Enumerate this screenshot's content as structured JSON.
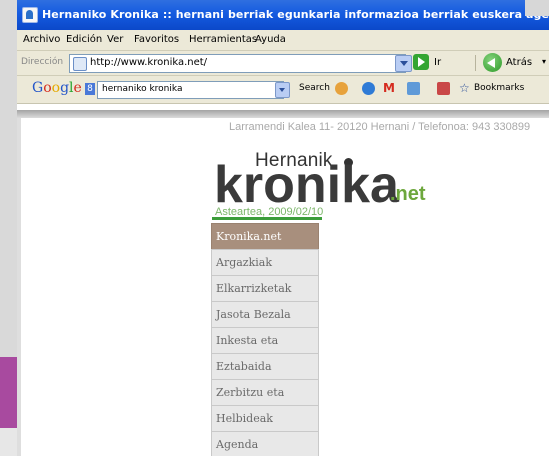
{
  "window": {
    "title": "Hernaniko Kronika :: hernani berriak egunkaria informazioa berriak euskera agenda argazkiak ika - Micro"
  },
  "menubar": {
    "items": [
      "Archivo",
      "Edición",
      "Ver",
      "Favoritos",
      "Herramientas",
      "Ayuda"
    ]
  },
  "addressbar": {
    "label": "Dirección",
    "url": "http://www.kronika.net/",
    "go_label": "Ir",
    "back_label": "Atrás",
    "back_icon": "back-arrow-icon"
  },
  "googlebar": {
    "logo": [
      "G",
      "o",
      "o",
      "g",
      "l",
      "e"
    ],
    "search_query": "hernaniko kronika",
    "search_button": "Search",
    "bookmarks_label": "Bookmarks"
  },
  "page": {
    "address_line": "Larramendi Kalea 11- 20120 Hernani / Telefonoa: 943 330899",
    "logo": {
      "hernanik": "Hernanik",
      "kronika": "kronika",
      "net": ".net"
    },
    "date": "Asteartea, 2009/02/10",
    "nav": [
      {
        "label": "Kronika.net",
        "active": true
      },
      {
        "label": "Argazkiak",
        "active": false
      },
      {
        "label": "Elkarrizketak",
        "active": false
      },
      {
        "label": "Jasota Bezala",
        "active": false
      },
      {
        "label": "Inkesta eta",
        "active": false
      },
      {
        "label": "Eztabaida",
        "active": false
      },
      {
        "label": "Zerbitzu eta",
        "active": false
      },
      {
        "label": "Helbideak",
        "active": false
      },
      {
        "label": "Agenda",
        "active": false
      }
    ]
  },
  "colors": {
    "titlebar": "#155be0",
    "chrome": "#ece9d8",
    "menu_active": "#a88f7d",
    "menu_item": "#e8e8e8",
    "logo_net": "#6da73c",
    "date_green": "#7cb66a",
    "accent_purple": "#a84a9f"
  }
}
